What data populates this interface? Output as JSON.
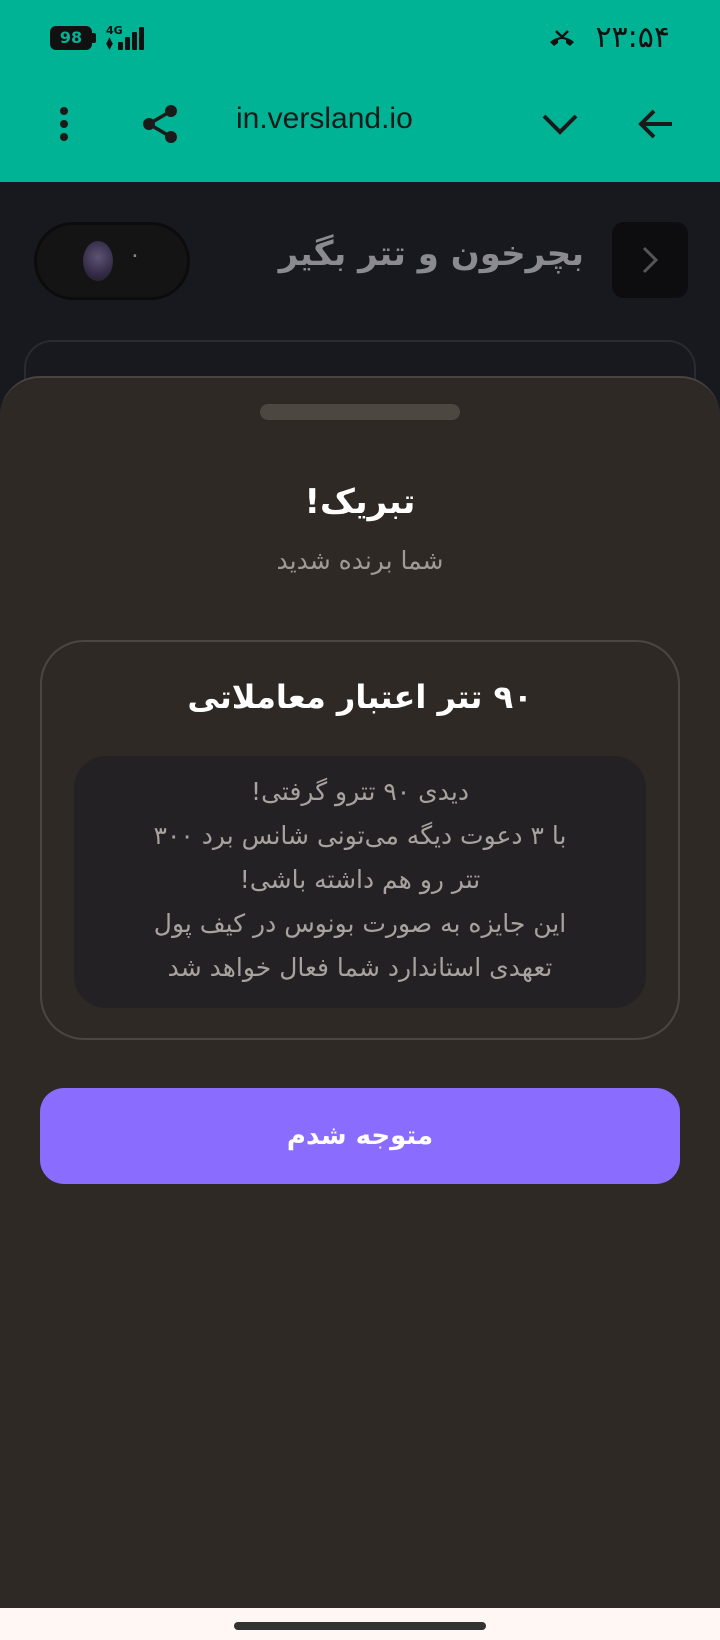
{
  "status_bar": {
    "battery": "98",
    "network": "4G",
    "time": "۲۳:۵۴"
  },
  "toolbar": {
    "url": "in.versland.io"
  },
  "page": {
    "title": "بچرخون و تتر بگیر",
    "coin_count": "۰"
  },
  "sheet": {
    "title": "تبریک!",
    "subtitle": "شما برنده شدید",
    "prize": {
      "title": "۹۰ تتر اعتبار معاملاتی",
      "lines": [
        "دیدی ۹۰ تترو گرفتی!",
        "با ۳ دعوت دیگه می‌تونی شانس برد ۳۰۰",
        "تتر رو هم داشته باشی!",
        "این جایزه به صورت بونوس در کیف پول",
        "تعهدی استاندارد شما فعال خواهد شد"
      ]
    },
    "button_label": "متوجه شدم"
  },
  "icons": {
    "back": "arrow-left-icon",
    "dropdown": "chevron-down-icon",
    "share": "share-icon",
    "menu": "more-vert-icon",
    "page_back": "chevron-right-icon"
  },
  "colors": {
    "brand": "#00b394",
    "accent": "#8a6cff",
    "sheet": "#2f2925"
  }
}
